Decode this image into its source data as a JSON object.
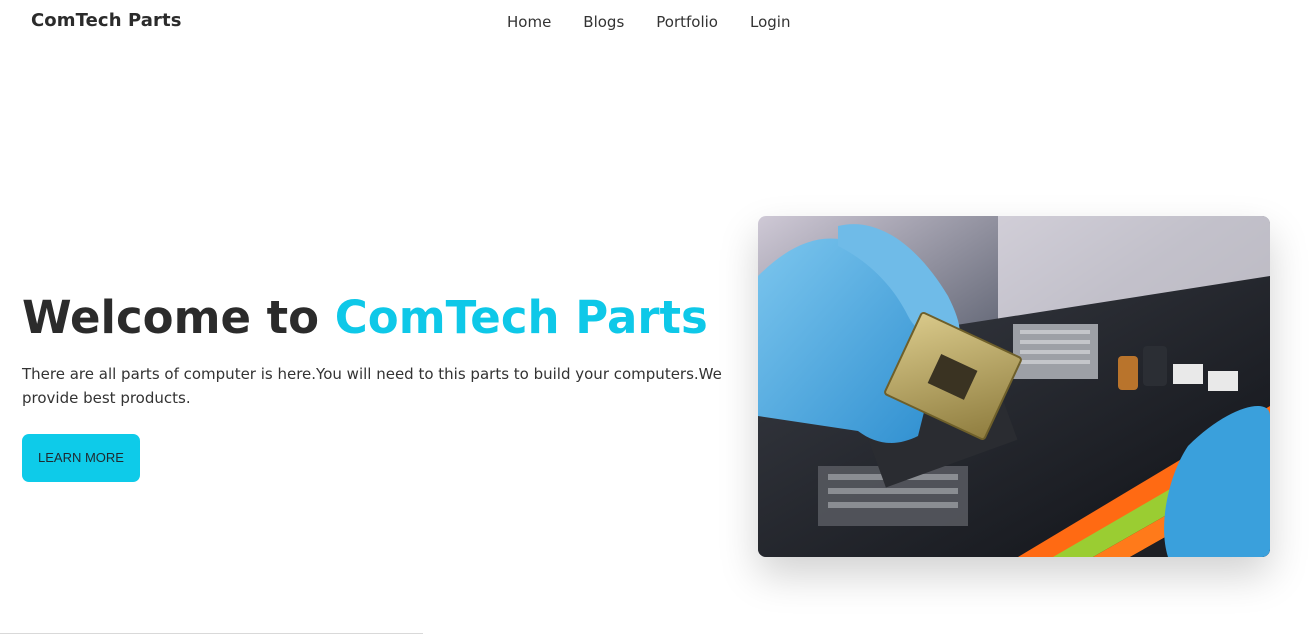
{
  "navbar": {
    "brand": "ComTech Parts",
    "links": [
      {
        "label": "Home"
      },
      {
        "label": "Blogs"
      },
      {
        "label": "Portfolio"
      },
      {
        "label": "Login"
      }
    ]
  },
  "hero": {
    "title_prefix": "Welcome to ",
    "title_accent": "ComTech Parts",
    "description": "There are all parts of computer is here.You will need to this parts to build your computers.We provide best products.",
    "button_label": "LEARN MORE",
    "image_alt": "CPU being installed on motherboard"
  },
  "colors": {
    "accent": "#0ec8e8",
    "button_bg": "#0ecbe9",
    "text_dark": "#2b2b2b"
  }
}
